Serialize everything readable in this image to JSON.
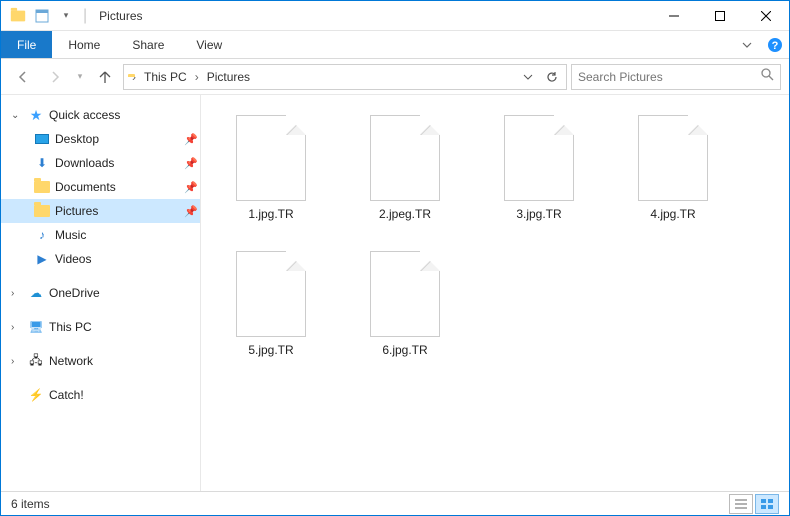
{
  "window": {
    "title": "Pictures"
  },
  "ribbon": {
    "file": "File",
    "tabs": [
      "Home",
      "Share",
      "View"
    ]
  },
  "breadcrumb": {
    "items": [
      "This PC",
      "Pictures"
    ]
  },
  "search": {
    "placeholder": "Search Pictures"
  },
  "sidebar": {
    "quickaccess": {
      "label": "Quick access",
      "items": [
        {
          "label": "Desktop",
          "pinned": true
        },
        {
          "label": "Downloads",
          "pinned": true
        },
        {
          "label": "Documents",
          "pinned": true
        },
        {
          "label": "Pictures",
          "pinned": true,
          "selected": true
        },
        {
          "label": "Music",
          "pinned": false
        },
        {
          "label": "Videos",
          "pinned": false
        }
      ]
    },
    "roots": [
      {
        "label": "OneDrive"
      },
      {
        "label": "This PC"
      },
      {
        "label": "Network"
      },
      {
        "label": "Catch!"
      }
    ]
  },
  "files": [
    {
      "name": "1.jpg.TR"
    },
    {
      "name": "2.jpeg.TR"
    },
    {
      "name": "3.jpg.TR"
    },
    {
      "name": "4.jpg.TR"
    },
    {
      "name": "5.jpg.TR"
    },
    {
      "name": "6.jpg.TR"
    }
  ],
  "statusbar": {
    "count": "6 items"
  }
}
